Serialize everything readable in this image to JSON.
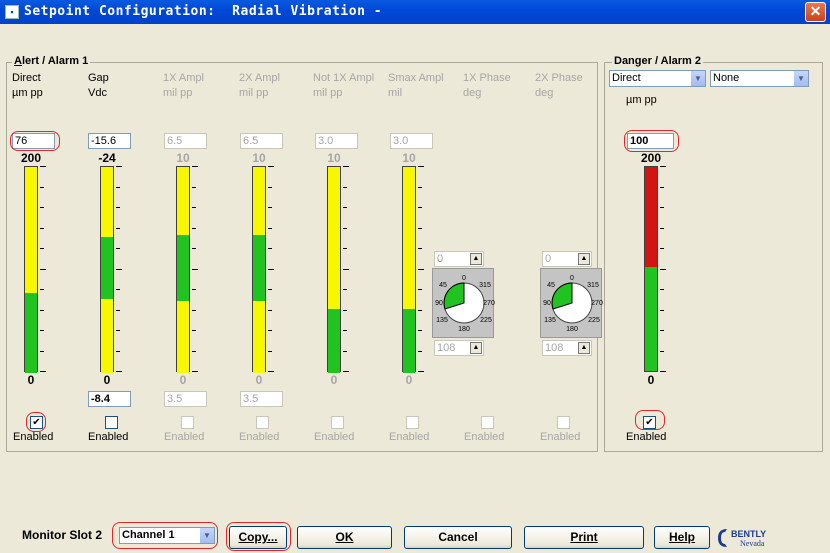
{
  "window": {
    "title": "Setpoint Configuration:  Radial Vibration -",
    "close_glyph": "✕"
  },
  "alert": {
    "title_prefix": "A",
    "title_rest": "lert / Alarm 1",
    "columns": [
      {
        "l1": "Direct",
        "l2": "µm  pp",
        "value": "76",
        "top": "200",
        "bot": "0",
        "enabled_label": "Enabled",
        "checked": "✔",
        "low": ""
      },
      {
        "l1": "Gap",
        "l2": "Vdc",
        "value": "-15.6",
        "top": "-24",
        "bot": "0",
        "enabled_label": "Enabled",
        "checked": "",
        "low": "-8.4"
      },
      {
        "l1": "1X Ampl",
        "l2": "mil  pp",
        "value": "6.5",
        "top": "10",
        "bot": "0",
        "enabled_label": "Enabled",
        "checked": "",
        "low": "3.5"
      },
      {
        "l1": "2X Ampl",
        "l2": "mil  pp",
        "value": "6.5",
        "top": "10",
        "bot": "0",
        "enabled_label": "Enabled",
        "checked": "",
        "low": "3.5"
      },
      {
        "l1": "Not 1X Ampl",
        "l2": "mil  pp",
        "value": "3.0",
        "top": "10",
        "bot": "0",
        "enabled_label": "Enabled",
        "checked": "",
        "low": ""
      },
      {
        "l1": "Smax Ampl",
        "l2": "mil",
        "value": "3.0",
        "top": "10",
        "bot": "0",
        "enabled_label": "Enabled",
        "checked": "",
        "low": ""
      },
      {
        "l1": "1X Phase",
        "l2": "deg",
        "value": "",
        "top": "",
        "bot": "",
        "enabled_label": "Enabled",
        "checked": "",
        "low": ""
      },
      {
        "l1": "2X Phase",
        "l2": "deg",
        "value": "",
        "top": "",
        "bot": "",
        "enabled_label": "Enabled",
        "checked": "",
        "low": ""
      }
    ],
    "phase": [
      {
        "top_value": "0",
        "bot_value": "108",
        "d0": "0",
        "d45": "45",
        "d90": "90",
        "d135": "135",
        "d180": "180",
        "d225": "225",
        "d270": "270",
        "d315": "315"
      },
      {
        "top_value": "0",
        "bot_value": "108",
        "d0": "0",
        "d45": "45",
        "d90": "90",
        "d135": "135",
        "d180": "180",
        "d225": "225",
        "d270": "270",
        "d315": "315"
      }
    ],
    "spin_up": "▲",
    "spin_down": "▼"
  },
  "danger": {
    "title": "Danger / Alarm 2",
    "select_mode": "Direct",
    "select_second": "None",
    "unit": "µm  pp",
    "value": "100",
    "top": "200",
    "bot": "0",
    "enabled_label": "Enabled",
    "checked": "✔"
  },
  "footer": {
    "monitor_label": "Monitor Slot 2",
    "channel": "Channel 1",
    "copy": "Copy...",
    "ok": "OK",
    "cancel": "Cancel",
    "print": "Print",
    "help": "Help",
    "logo_top": "BENTLY",
    "logo_bot": "Nevada"
  },
  "colors": {
    "green": "#21c321",
    "yellow": "#f7f700",
    "red": "#d21414",
    "highlight": "#e3262b"
  }
}
